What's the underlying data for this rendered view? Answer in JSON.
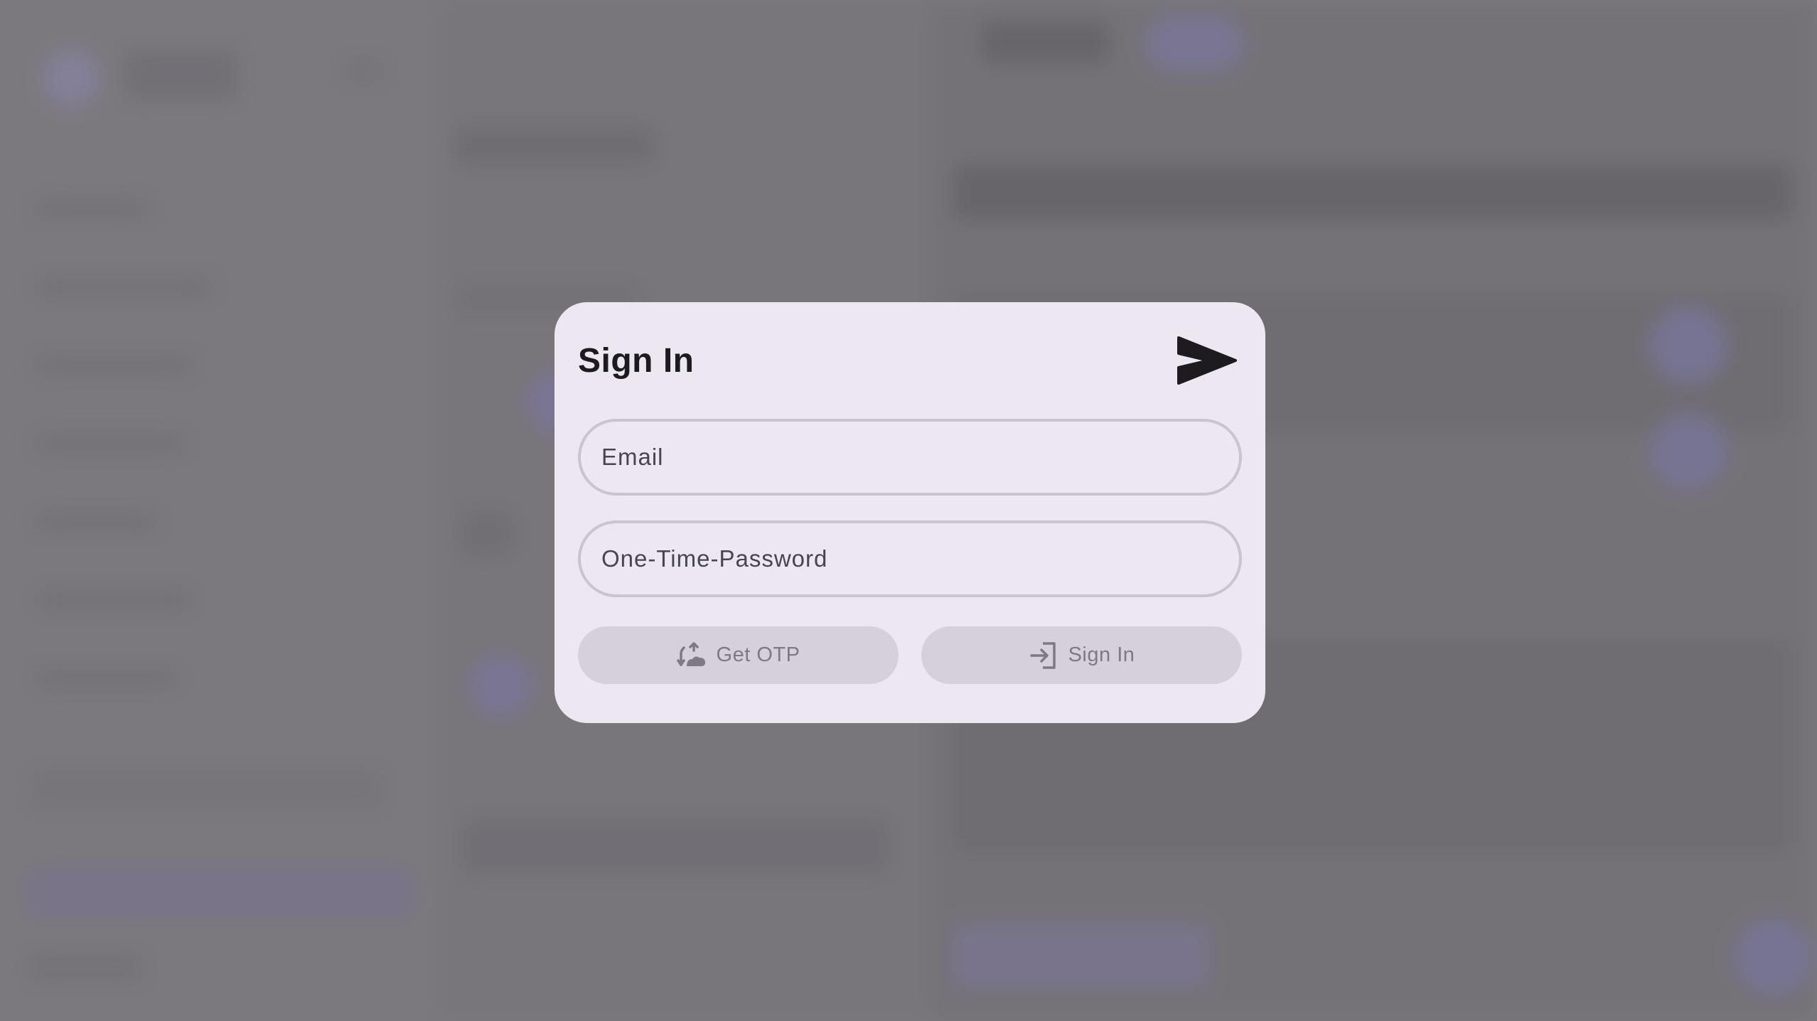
{
  "dialog": {
    "title": "Sign In",
    "email_placeholder": "Email",
    "otp_placeholder": "One-Time-Password",
    "get_otp_label": "Get OTP",
    "sign_in_label": "Sign In"
  },
  "icons": {
    "header": "send-icon",
    "get_otp": "otp-request-icon",
    "sign_in": "login-icon"
  },
  "colors": {
    "dialog_bg": "#ede7f2",
    "field_border": "#cbc3cf",
    "button_bg": "#d6d0da",
    "button_text": "#7f7985",
    "title_text": "#1d1b20",
    "scrim": "#7e7b80"
  }
}
